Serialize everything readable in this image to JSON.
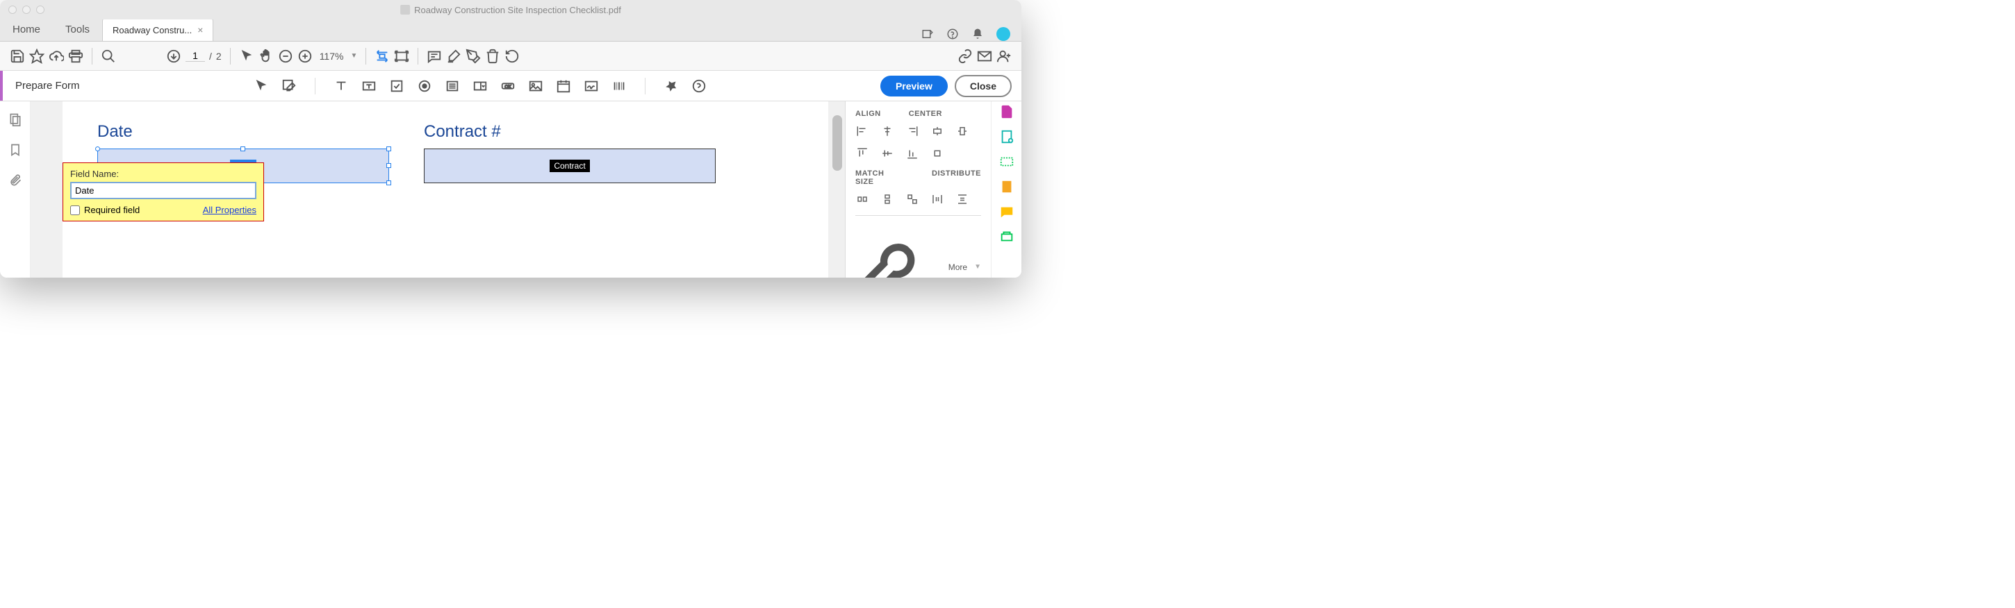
{
  "window": {
    "title": "Roadway Construction Site Inspection Checklist.pdf"
  },
  "tabs": {
    "home": "Home",
    "tools": "Tools",
    "doc": "Roadway Constru..."
  },
  "toolbar": {
    "page_current": "1",
    "page_sep": "/",
    "page_total": "2",
    "zoom": "117%"
  },
  "formbar": {
    "label": "Prepare Form",
    "preview": "Preview",
    "close": "Close"
  },
  "doc": {
    "date_label": "Date",
    "contract_label": "Contract #",
    "date_tag": "Date",
    "contract_tag": "Contract"
  },
  "popup": {
    "fieldname_label": "Field Name:",
    "fieldname_value": "Date",
    "required_label": "Required field",
    "all_props": "All Properties"
  },
  "right_panel": {
    "align": "ALIGN",
    "center": "CENTER",
    "match": "MATCH SIZE",
    "distribute": "DISTRIBUTE",
    "more": "More"
  }
}
